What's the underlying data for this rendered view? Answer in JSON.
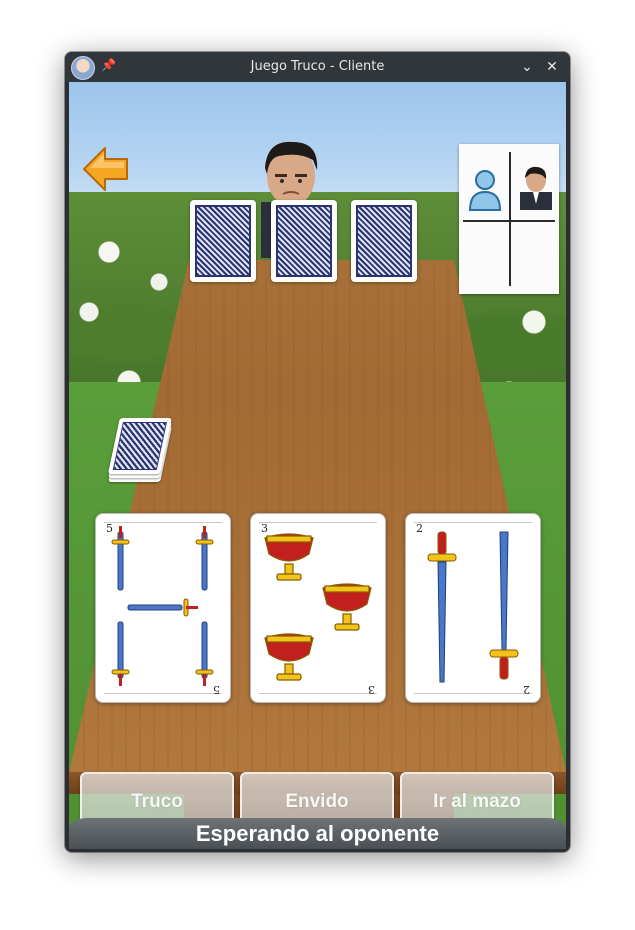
{
  "window": {
    "title": "Juego Truco - Cliente",
    "icon": "app-avatar-icon",
    "pin_icon": "pin-icon",
    "minimize_icon": "chevron-down-icon",
    "close_icon": "close-icon",
    "minimize_glyph": "⌄",
    "close_glyph": "✕"
  },
  "game": {
    "back_button_icon": "back-arrow-icon",
    "opponent_cards_face_down": 3,
    "deck_icon": "deck-icon",
    "scoreboard": {
      "player_icon": "player-silhouette-icon",
      "opponent_icon": "opponent-portrait-icon"
    },
    "hand": [
      {
        "rank": "5",
        "suit": "espadas"
      },
      {
        "rank": "3",
        "suit": "copas"
      },
      {
        "rank": "2",
        "suit": "espadas"
      }
    ],
    "actions": {
      "truco": "Truco",
      "envido": "Envido",
      "mazo": "Ir al mazo"
    },
    "status": "Esperando al oponente"
  },
  "colors": {
    "titlebar": "#31363b",
    "table_wood": "#a26a34",
    "card_back": "#2a3470",
    "cup_red": "#c21f1f",
    "sword_blue": "#4a78c8",
    "arrow_orange": "#f5a623"
  }
}
